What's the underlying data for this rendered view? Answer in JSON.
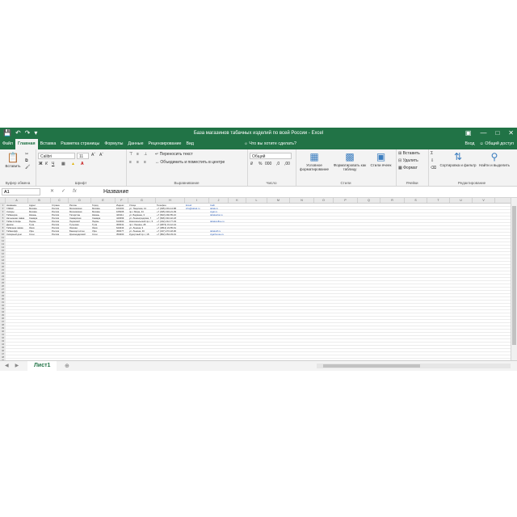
{
  "window": {
    "title": "База магазинов табачных изделий по всей России - Excel",
    "qat_icons": [
      "save-icon",
      "undo-icon",
      "redo-icon",
      "customize-qat-icon"
    ],
    "controls": [
      "restore-ribbon-icon",
      "minimize-icon",
      "maximize-icon",
      "close-icon"
    ]
  },
  "tabs": [
    {
      "label": "Файл"
    },
    {
      "label": "Главная"
    },
    {
      "label": "Вставка"
    },
    {
      "label": "Разметка страницы"
    },
    {
      "label": "Формулы"
    },
    {
      "label": "Данные"
    },
    {
      "label": "Рецензирование"
    },
    {
      "label": "Вид"
    }
  ],
  "tell_me": "Что вы хотите сделать?",
  "signin": "Вход",
  "share": "Общий доступ",
  "ribbon": {
    "paste_label": "Вставить",
    "clipboard_group": "Буфер обмена",
    "font_name": "Calibri",
    "font_size": "11",
    "font_group": "Шрифт",
    "wrap_text": "Переносить текст",
    "merge_center": "Объединить и поместить в центре",
    "alignment_group": "Выравнивание",
    "number_format": "Общий",
    "number_group": "Число",
    "conditional_formatting": "Условное форматирование",
    "format_as_table": "Форматировать как таблицу",
    "cell_styles": "Стили ячеек",
    "styles_group": "Стили",
    "insert": "Вставить",
    "delete": "Удалить",
    "format": "Формат",
    "cells_group": "Ячейки",
    "sort_filter": "Сортировка и фильтр",
    "find_select": "Найти и выделить",
    "editing_group": "Редактирование"
  },
  "formula_bar": {
    "name_box": "A1",
    "formula": "Название"
  },
  "columns": [
    "A",
    "B",
    "C",
    "D",
    "E",
    "F",
    "G",
    "H",
    "I",
    "J",
    "K",
    "L",
    "M",
    "N",
    "O",
    "P",
    "Q",
    "R",
    "S",
    "T",
    "U",
    "V"
  ],
  "rows": [
    [
      "Название",
      "Адрес",
      "Страна",
      "Регион",
      "Город",
      "Индекс",
      "Улица",
      "Телефон",
      "Email",
      "Сайт"
    ],
    [
      "ТАБАК",
      "Москва",
      "Россия",
      "Московская",
      "Москва",
      "101000",
      "ул. Тверская, 12",
      "+7 (495) 201-14-88",
      "info@tabak.ru",
      "tabak.ru"
    ],
    [
      "Сигары",
      "Москва",
      "Россия",
      "Московская",
      "Москва",
      "105005",
      "пр-т Мира, 44",
      "+7 (495) 334-21-09",
      "",
      "cigar.ru"
    ],
    [
      "Табакерка",
      "Казань",
      "Россия",
      "Татарстан",
      "Казань",
      "420111",
      "ул. Баумана, 3",
      "+7 (843) 292-55-10",
      "",
      "tabakerka.ru"
    ],
    [
      "Кальянная лавка",
      "Самара",
      "Россия",
      "Самарская",
      "Самара",
      "443099",
      "ул. Ленинградская, 7",
      "+7 (846) 310-42-18",
      "",
      ""
    ],
    [
      "Табак & Кофе",
      "Пермь",
      "Россия",
      "Пермский",
      "Пермь",
      "614000",
      "Комсомольский пр-т, 5",
      "+7 (342) 212-77-03",
      "",
      "tabakcoffee.ru"
    ],
    [
      "Дымок",
      "Тула",
      "Россия",
      "Тульская",
      "Тула",
      "300041",
      "пр-т Ленина, 28",
      "+7 (4872) 31-12-44",
      "",
      ""
    ],
    [
      "Табачная лавка",
      "Омск",
      "Россия",
      "Омская",
      "Омск",
      "644043",
      "ул. Ленина, 9",
      "+7 (3812) 24-55-61",
      "",
      ""
    ],
    [
      "Табакофф",
      "Уфа",
      "Россия",
      "Башкортостан",
      "Уфа",
      "450077",
      "ул. Ленина, 40",
      "+7 (347) 272-18-90",
      "",
      "tabakoff.ru"
    ],
    [
      "Сигарный дом",
      "Сочи",
      "Россия",
      "Краснодарский",
      "Сочи",
      "354000",
      "Курортный пр-т, 18",
      "+7 (862) 264-33-01",
      "",
      "cigarhouse.ru"
    ]
  ]
}
